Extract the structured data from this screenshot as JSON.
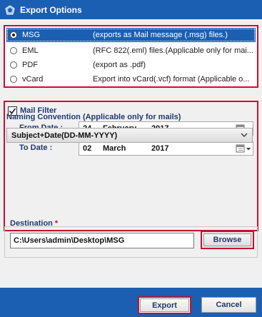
{
  "window": {
    "title": "Export Options",
    "icon": "app-logo-icon"
  },
  "export_options": [
    {
      "label": "MSG",
      "description": "(exports as Mail message (.msg) files.)",
      "selected": true
    },
    {
      "label": "EML",
      "description": "(RFC 822(.eml) files.(Applicable only for mai...",
      "selected": false
    },
    {
      "label": "PDF",
      "description": "(export as .pdf)",
      "selected": false
    },
    {
      "label": "vCard",
      "description": "Export into vCard(.vcf) format (Applicable o...",
      "selected": false
    }
  ],
  "mail_filter": {
    "label": "Mail Filter",
    "checked": true,
    "from_label": "From Date :",
    "from_day": "24",
    "from_month": "February",
    "from_year": "2017",
    "to_label": "To Date :",
    "to_day": "02",
    "to_month": "March",
    "to_year": "2017"
  },
  "naming": {
    "title": "Naming Convention (Applicable only for mails)",
    "selected": "Subject+Date(DD-MM-YYYY)"
  },
  "destination": {
    "label": "Destination",
    "required_mark": "*",
    "path": "C:\\Users\\admin\\Desktop\\MSG",
    "browse_label": "Browse"
  },
  "footer": {
    "export_label": "Export",
    "cancel_label": "Cancel"
  },
  "colors": {
    "accent": "#1b5fb2",
    "highlight_border": "#c8102e"
  }
}
